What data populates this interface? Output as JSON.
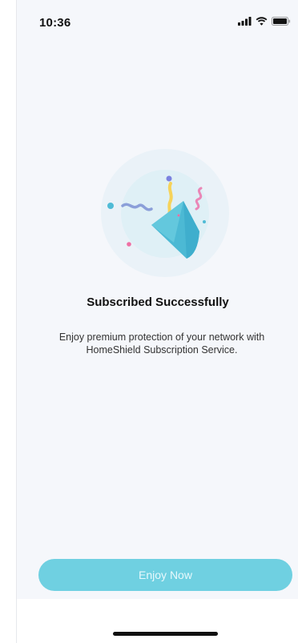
{
  "status_bar": {
    "time": "10:36",
    "icons": [
      "cellular-signal-icon",
      "wifi-icon",
      "battery-icon"
    ]
  },
  "illustration": {
    "name": "party-popper-illustration",
    "colors": {
      "circle_outer": "#eaf2f8",
      "circle_inner": "#dff0f6",
      "cone": "#4cb9d4",
      "streamer_yellow": "#f6d35a",
      "streamer_blue": "#8b9fd9",
      "streamer_pink": "#ea87b7",
      "dot_cyan": "#4fbbd6",
      "dot_purple": "#7b82e0",
      "dot_pink": "#ef6fa4"
    }
  },
  "content": {
    "title": "Subscribed Successfully",
    "description": "Enjoy premium protection of your network with HomeShield Subscription Service."
  },
  "actions": {
    "enjoy_now_label": "Enjoy Now",
    "accent_color": "#6fd0e1"
  }
}
